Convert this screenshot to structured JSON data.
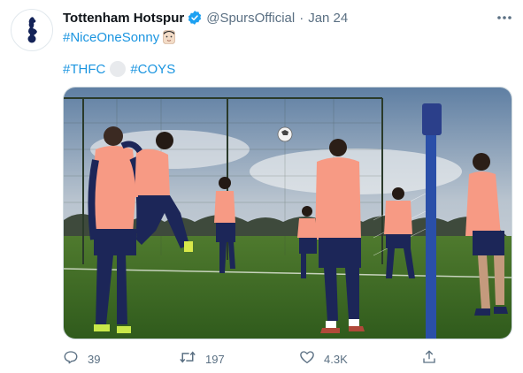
{
  "tweet": {
    "author": {
      "display_name": "Tottenham Hotspur",
      "handle": "@SpursOfficial",
      "verified": true,
      "avatar_icon": "spurs-cockerel-crest"
    },
    "separator": "·",
    "timestamp": "Jan 24",
    "body": {
      "line1": {
        "hashtag": "#NiceOneSonny",
        "emoji": "man-face-emoji"
      },
      "line2": {
        "hashtag1": "#THFC",
        "emoji": "soccer-ball-emoji",
        "hashtag2": "#COYS"
      }
    },
    "media": {
      "type": "photo",
      "icon": "training-photo"
    },
    "actions": {
      "reply": {
        "icon": "reply-icon",
        "count": "39"
      },
      "retweet": {
        "icon": "retweet-icon",
        "count": "197"
      },
      "like": {
        "icon": "heart-icon",
        "count": "4.3K"
      },
      "share": {
        "icon": "share-icon"
      }
    }
  },
  "colors": {
    "hashtag": "#1b95e0",
    "muted": "#5b7083",
    "verified": "#1da1f2",
    "kit_pink": "#f79a84",
    "kit_navy": "#1c2658"
  }
}
